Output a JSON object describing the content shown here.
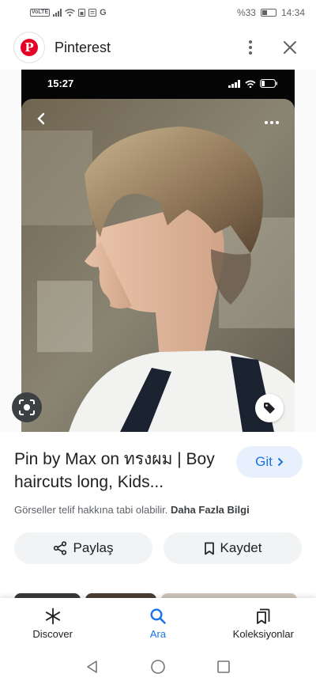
{
  "status_bar": {
    "left_icons": [
      "volte-icon",
      "signal-icon",
      "wifi-icon",
      "sim-icon",
      "notification-icon",
      "google-icon"
    ],
    "google_letter": "G",
    "battery_text": "%33",
    "time": "14:34"
  },
  "header": {
    "site_name": "Pinterest"
  },
  "image": {
    "phone_time": "15:27"
  },
  "info": {
    "title": "Pin by Max on ทรงผม | Boy haircuts long, Kids...",
    "go_label": "Git",
    "copyright_text": "Görseller telif hakkına tabi olabilir.",
    "more_info_label": "Daha Fazla Bilgi"
  },
  "actions": {
    "share_label": "Paylaş",
    "save_label": "Kaydet"
  },
  "bottom_nav": [
    {
      "label": "Discover",
      "icon": "asterisk-icon",
      "active": false
    },
    {
      "label": "Ara",
      "icon": "search-icon",
      "active": true
    },
    {
      "label": "Koleksiyonlar",
      "icon": "collections-icon",
      "active": false
    }
  ],
  "colors": {
    "accent": "#1a73e8",
    "pinterest_red": "#e60023"
  }
}
